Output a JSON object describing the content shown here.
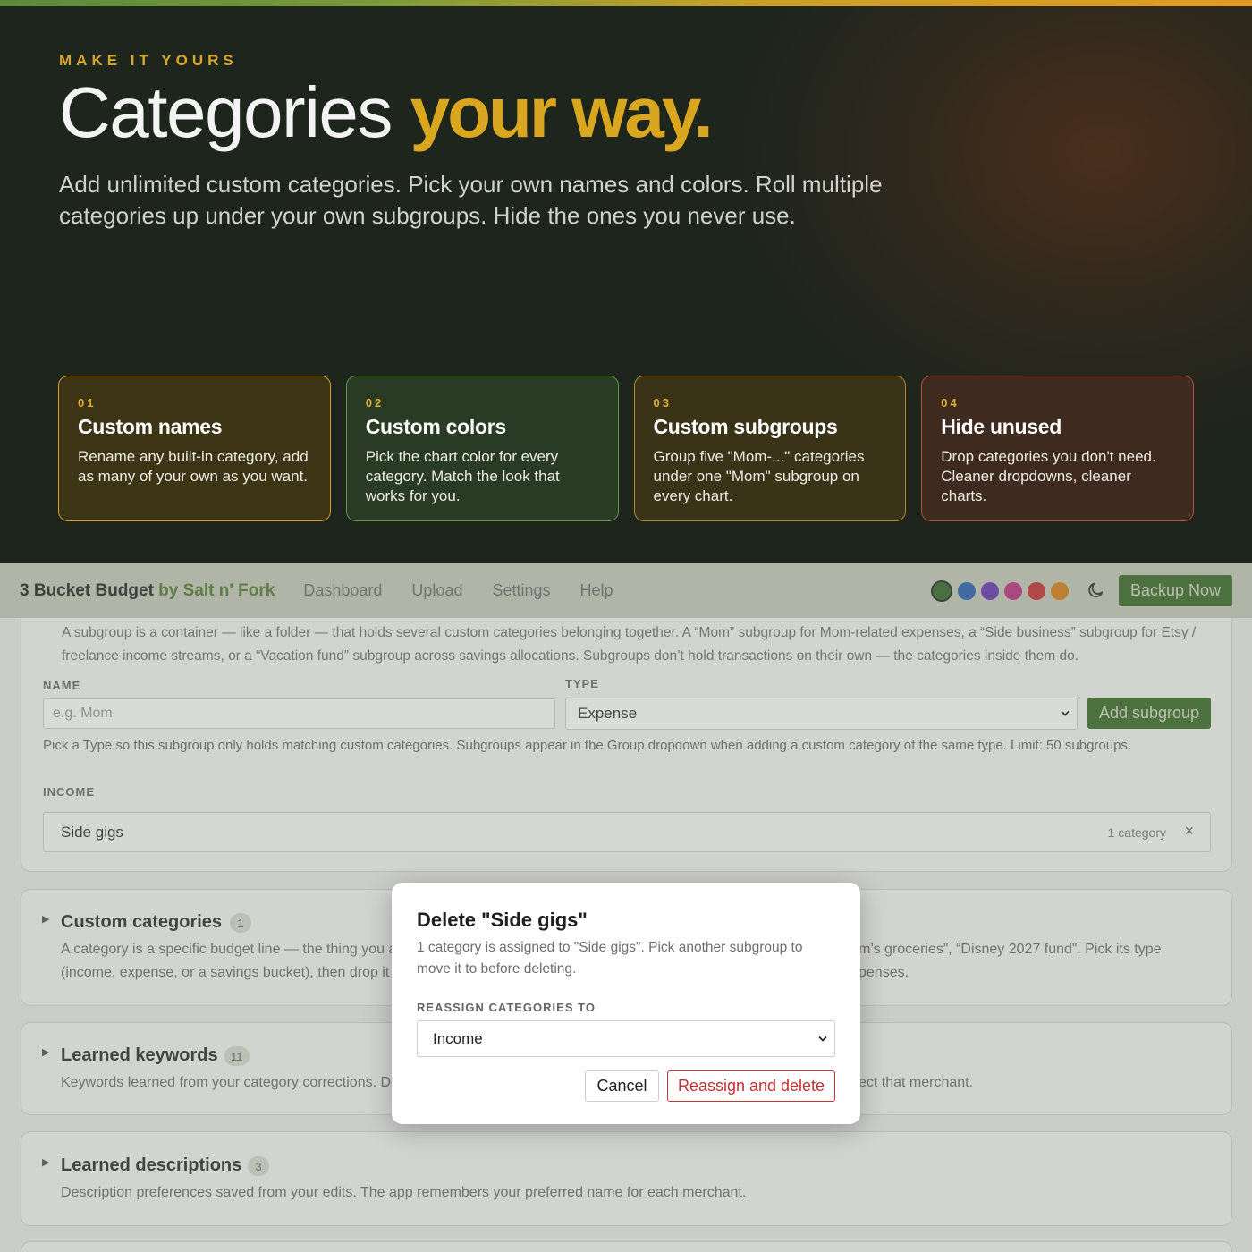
{
  "hero": {
    "eyebrow": "MAKE IT YOURS",
    "title_plain": "Categories ",
    "title_accent": "your way.",
    "subtitle": "Add unlimited custom categories. Pick your own names and colors. Roll multiple categories up under your own subgroups. Hide the ones you never use.",
    "cards": [
      {
        "num": "01",
        "title": "Custom names",
        "desc": "Rename any built-in category, add as many of your own as you want."
      },
      {
        "num": "02",
        "title": "Custom colors",
        "desc": "Pick the chart color for every category. Match the look that works for you."
      },
      {
        "num": "03",
        "title": "Custom subgroups",
        "desc": "Group five \"Mom-...\" categories under one \"Mom\" subgroup on every chart."
      },
      {
        "num": "04",
        "title": "Hide unused",
        "desc": "Drop categories you don't need. Cleaner dropdowns, cleaner charts."
      }
    ]
  },
  "nav": {
    "brand": "3 Bucket Budget",
    "brand_by": " by Salt n' Fork",
    "links": [
      "Dashboard",
      "Upload",
      "Settings",
      "Help"
    ],
    "swatches": [
      "#3a6a2e",
      "#2e63b8",
      "#6a3ab8",
      "#c0348a",
      "#c8323a",
      "#d8801e"
    ],
    "backup_label": "Backup Now"
  },
  "subgroups": {
    "intro": "A subgroup is a container — like a folder — that holds several custom categories belonging together. A “Mom” subgroup for Mom-related expenses, a “Side business” subgroup for Etsy / freelance income streams, or a “Vacation fund” subgroup across savings allocations. Subgroups don’t hold transactions on their own — the categories inside them do.",
    "name_label": "NAME",
    "name_placeholder": "e.g. Mom",
    "type_label": "TYPE",
    "type_value": "Expense",
    "add_label": "Add subgroup",
    "hint": "Pick a Type so this subgroup only holds matching custom categories. Subgroups appear in the Group dropdown when adding a custom category of the same type. Limit: 50 subgroups.",
    "income_label": "INCOME",
    "rows": [
      {
        "name": "Side gigs",
        "count": "1 category",
        "remove": "×"
      }
    ]
  },
  "sections": [
    {
      "title": "Custom categories",
      "badge": "1",
      "desc_left": "A category is a specific budget line — the thing you a",
      "desc_left2": "(income, expense, or a savings bucket), then drop it i",
      "desc_right": "m’s groceries”, “Disney 2027 fund”. Pick its type",
      "desc_right2": "penses."
    },
    {
      "title": "Learned keywords",
      "badge": "11",
      "desc_left": "Keywords learned from your category corrections. De",
      "desc_right": "ect that merchant."
    },
    {
      "title": "Learned descriptions",
      "badge": "3",
      "desc": "Description preferences saved from your edits. The app remembers your preferred name for each merchant."
    }
  ],
  "modal": {
    "title": "Delete \"Side gigs\"",
    "desc": "1 category is assigned to \"Side gigs\". Pick another subgroup to move it to before deleting.",
    "label": "REASSIGN CATEGORIES TO",
    "select_value": "Income",
    "cancel": "Cancel",
    "confirm": "Reassign and delete"
  }
}
